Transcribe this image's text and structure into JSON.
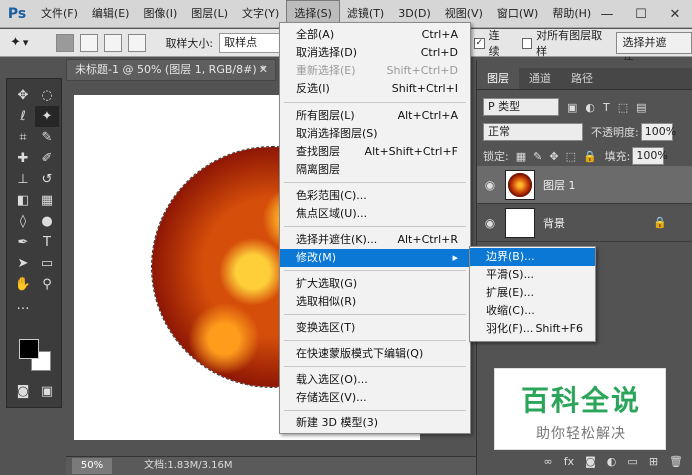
{
  "menubar": {
    "logo": "Ps",
    "items": [
      "文件(F)",
      "编辑(E)",
      "图像(I)",
      "图层(L)",
      "文字(Y)",
      "选择(S)",
      "滤镜(T)",
      "3D(D)",
      "视图(V)",
      "窗口(W)",
      "帮助(H)"
    ],
    "window_controls": [
      "—",
      "☐",
      "✕"
    ]
  },
  "options_bar": {
    "sample_size_label": "取样大小:",
    "sample_size_value": "取样点",
    "contiguous_label": "连续",
    "contiguous_checked": true,
    "all_layers_label": "对所有图层取样",
    "all_layers_checked": false,
    "select_mask_button": "选择并遮住..."
  },
  "document": {
    "tab_title": "未标题-1 @ 50% (图层 1, RGB/8#) *",
    "zoom": "50%",
    "info": "文档:1.83M/3.16M"
  },
  "layers_panel": {
    "tabs": [
      "图层",
      "通道",
      "路径"
    ],
    "filter": "P 类型",
    "blend_mode": "正常",
    "opacity_label": "不透明度:",
    "opacity": "100%",
    "lock_label": "锁定:",
    "fill_label": "填充:",
    "fill": "100%",
    "layers": [
      {
        "name": "图层 1",
        "selected": true,
        "locked": false
      },
      {
        "name": "背景",
        "selected": false,
        "locked": true
      }
    ]
  },
  "select_menu": {
    "items": [
      {
        "label": "全部(A)",
        "shortcut": "Ctrl+A",
        "disabled": false
      },
      {
        "label": "取消选择(D)",
        "shortcut": "Ctrl+D",
        "disabled": false
      },
      {
        "label": "重新选择(E)",
        "shortcut": "Shift+Ctrl+D",
        "disabled": true
      },
      {
        "label": "反选(I)",
        "shortcut": "Shift+Ctrl+I",
        "disabled": false
      },
      {
        "label": "所有图层(L)",
        "shortcut": "Alt+Ctrl+A",
        "disabled": false
      },
      {
        "label": "取消选择图层(S)",
        "shortcut": "",
        "disabled": false
      },
      {
        "label": "查找图层",
        "shortcut": "Alt+Shift+Ctrl+F",
        "disabled": false
      },
      {
        "label": "隔离图层",
        "shortcut": "",
        "disabled": false
      },
      {
        "label": "色彩范围(C)...",
        "shortcut": "",
        "disabled": false
      },
      {
        "label": "焦点区域(U)...",
        "shortcut": "",
        "disabled": false
      },
      {
        "label": "选择并遮住(K)...",
        "shortcut": "Alt+Ctrl+R",
        "disabled": false
      },
      {
        "label": "修改(M)",
        "shortcut": "",
        "disabled": false,
        "highlighted": true
      },
      {
        "label": "扩大选取(G)",
        "shortcut": "",
        "disabled": false
      },
      {
        "label": "选取相似(R)",
        "shortcut": "",
        "disabled": false
      },
      {
        "label": "变换选区(T)",
        "shortcut": "",
        "disabled": false
      },
      {
        "label": "在快速蒙版模式下编辑(Q)",
        "shortcut": "",
        "disabled": false
      },
      {
        "label": "载入选区(O)...",
        "shortcut": "",
        "disabled": false
      },
      {
        "label": "存储选区(V)...",
        "shortcut": "",
        "disabled": false
      },
      {
        "label": "新建 3D 模型(3)",
        "shortcut": "",
        "disabled": false
      }
    ]
  },
  "modify_submenu": {
    "items": [
      {
        "label": "边界(B)...",
        "shortcut": "",
        "highlighted": true
      },
      {
        "label": "平滑(S)...",
        "shortcut": ""
      },
      {
        "label": "扩展(E)...",
        "shortcut": ""
      },
      {
        "label": "收缩(C)...",
        "shortcut": ""
      },
      {
        "label": "羽化(F)...",
        "shortcut": "Shift+F6"
      }
    ]
  },
  "watermark": {
    "title": "百科全说",
    "subtitle": "助你轻松解决"
  },
  "colors": {
    "highlight": "#0a78d4",
    "watermark_green": "#2aa55a"
  }
}
